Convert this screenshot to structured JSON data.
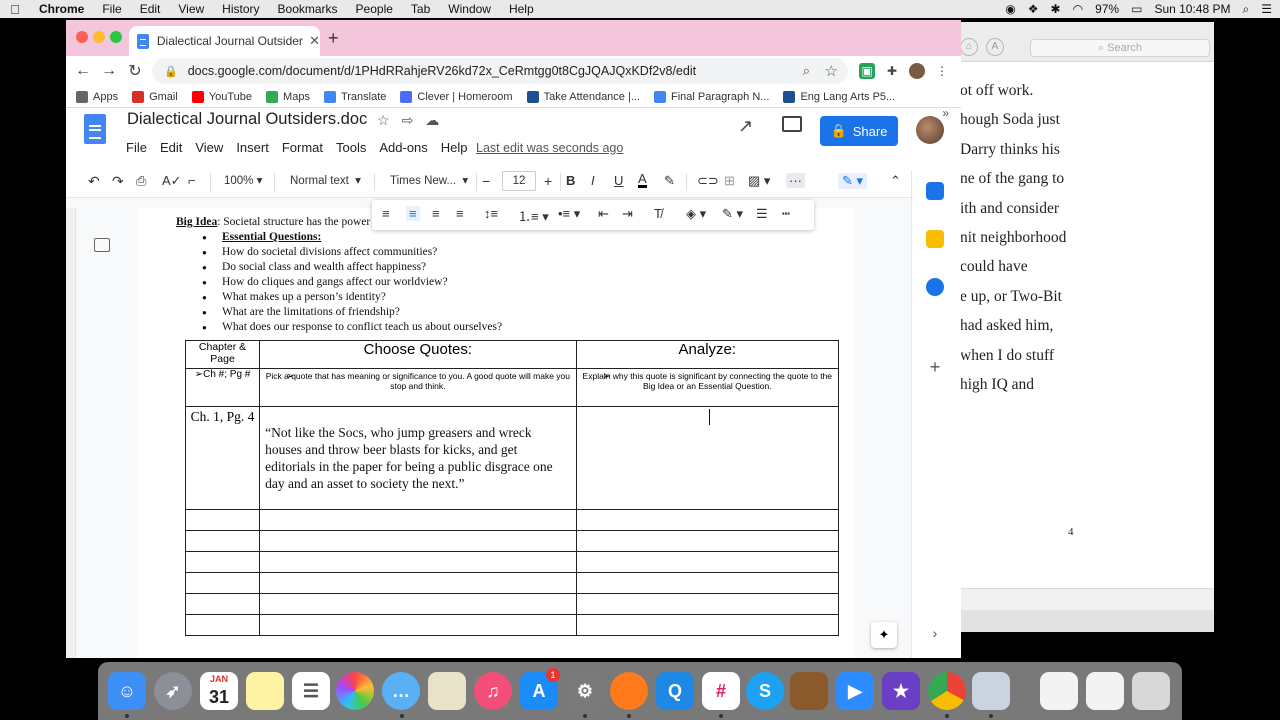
{
  "menubar": {
    "app": "Chrome",
    "items": [
      "File",
      "Edit",
      "View",
      "History",
      "Bookmarks",
      "People",
      "Tab",
      "Window",
      "Help"
    ],
    "battery": "97%",
    "clock": "Sun 10:48 PM"
  },
  "background_window": {
    "search_placeholder": "Search",
    "lines": [
      "ot off work.",
      "hough Soda just",
      "Darry thinks his",
      "ne of the gang to",
      "ith and consider",
      "nit neighborhood",
      "could have",
      "e up, or Two-Bit",
      "had asked him,",
      "when I do stuff",
      "high IQ and"
    ],
    "page_number": "4"
  },
  "browser": {
    "tab_title": "Dialectical Journal Outsiders.doc",
    "url": "docs.google.com/document/d/1PHdRRahjeRV26kd72x_CeRmtgg0t8CgJQAJQxKDf2v8/edit",
    "bookmarks": [
      {
        "label": "Apps",
        "color": "#666"
      },
      {
        "label": "Gmail",
        "color": "#d93025"
      },
      {
        "label": "YouTube",
        "color": "#ff0000"
      },
      {
        "label": "Maps",
        "color": "#34a853"
      },
      {
        "label": "Translate",
        "color": "#4285f4"
      },
      {
        "label": "Clever | Homeroom",
        "color": "#4a6cf7"
      },
      {
        "label": "Take Attendance |...",
        "color": "#1d4f91"
      },
      {
        "label": "Final Paragraph N...",
        "color": "#4285f4"
      },
      {
        "label": "Eng Lang Arts P5...",
        "color": "#1d4f91"
      }
    ]
  },
  "docs": {
    "title": "Dialectical Journal Outsiders.doc",
    "menu": [
      "File",
      "Edit",
      "View",
      "Insert",
      "Format",
      "Tools",
      "Add-ons",
      "Help"
    ],
    "last_edit": "Last edit was seconds ago",
    "share_label": "Share",
    "toolbar": {
      "zoom": "100%",
      "style": "Normal text",
      "font": "Times New...",
      "font_size": "12"
    }
  },
  "document": {
    "big_idea_label": "Big Idea",
    "big_idea_text": ": Societal structure has the power",
    "essential_heading": "Essential Questions",
    "questions": [
      "How do societal divisions affect communities?",
      "Do social class and wealth affect happiness?",
      "How do cliques and gangs affect our worldview?",
      "What makes up a person’s identity?",
      "What are the limitations of friendship?",
      "What does our response to conflict teach us about ourselves?"
    ],
    "table": {
      "col1_header": "Chapter & Page",
      "col2_header": "Choose Quotes:",
      "col3_header": "Analyze:",
      "col1_sub": "➢Ch #; Pg #",
      "col2_sub": "Pick a quote that has meaning or significance to you.  A good quote will make you stop and think.",
      "col3_sub": "Explain why this quote is significant by connecting the quote to the Big Idea or an Essential Question.",
      "row1_chapter": "Ch. 1, Pg. 4",
      "row1_quote": "“Not like the Socs, who jump greasers and wreck houses and throw beer blasts for kicks, and get editorials in the paper for being a public disgrace one day and an asset to society the next.”"
    }
  },
  "dock": {
    "calendar_month": "JAN",
    "calendar_day": "31",
    "appstore_badge": "1"
  }
}
